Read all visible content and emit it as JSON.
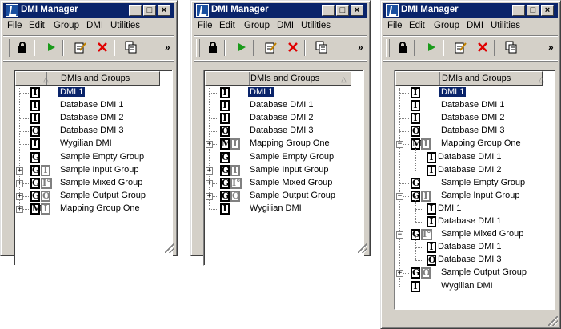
{
  "window": {
    "title": "DMI Manager",
    "controls": {
      "minimize": "_",
      "maximize": "□",
      "close": "×"
    },
    "menu": [
      "File",
      "Edit",
      "Group",
      "DMI",
      "Utilities"
    ],
    "toolbar_more": "»"
  },
  "column_header": "DMIs and Groups",
  "sort_indicator": "△",
  "expand_glyph": "+",
  "collapse_glyph": "−",
  "panels": [
    {
      "rows": [
        {
          "label": "DMI 1",
          "icon": "I",
          "selected": true
        },
        {
          "label": "Database DMI 1",
          "icon": "I"
        },
        {
          "label": "Database DMI 2",
          "icon": "I"
        },
        {
          "label": "Database DMI 3",
          "icon": "O"
        },
        {
          "label": "Wygilian DMI",
          "icon": "I"
        },
        {
          "label": "Sample Empty Group",
          "icon": "G"
        },
        {
          "label": "Sample Input Group",
          "icon": "GI",
          "expand": "+"
        },
        {
          "label": "Sample Mixed Group",
          "icon": "GIO",
          "expand": "+"
        },
        {
          "label": "Sample Output Group",
          "icon": "GO",
          "expand": "+"
        },
        {
          "label": "Mapping Group One",
          "icon": "MI",
          "expand": "+"
        }
      ]
    },
    {
      "rows": [
        {
          "label": "DMI 1",
          "icon": "I",
          "selected": true
        },
        {
          "label": "Database DMI 1",
          "icon": "I"
        },
        {
          "label": "Database DMI 2",
          "icon": "I"
        },
        {
          "label": "Database DMI 3",
          "icon": "O"
        },
        {
          "label": "Mapping Group One",
          "icon": "MI",
          "expand": "+"
        },
        {
          "label": "Sample Empty Group",
          "icon": "G"
        },
        {
          "label": "Sample Input Group",
          "icon": "GI",
          "expand": "+"
        },
        {
          "label": "Sample Mixed Group",
          "icon": "GIO",
          "expand": "+"
        },
        {
          "label": "Sample Output Group",
          "icon": "GO",
          "expand": "+"
        },
        {
          "label": "Wygilian DMI",
          "icon": "I"
        }
      ]
    },
    {
      "rows": [
        {
          "label": "DMI 1",
          "icon": "I",
          "selected": true
        },
        {
          "label": "Database DMI 1",
          "icon": "I"
        },
        {
          "label": "Database DMI 2",
          "icon": "I"
        },
        {
          "label": "Database DMI 3",
          "icon": "O"
        },
        {
          "label": "Mapping Group One",
          "icon": "MI",
          "expand": "-"
        },
        {
          "label": "Database DMI 1",
          "icon": "I",
          "child": true
        },
        {
          "label": "Database DMI 2",
          "icon": "I",
          "child": true
        },
        {
          "label": "Sample Empty Group",
          "icon": "G"
        },
        {
          "label": "Sample Input Group",
          "icon": "GI",
          "expand": "-"
        },
        {
          "label": "DMI 1",
          "icon": "I",
          "child": true
        },
        {
          "label": "Database DMI 1",
          "icon": "I",
          "child": true
        },
        {
          "label": "Sample Mixed Group",
          "icon": "GIO",
          "expand": "-"
        },
        {
          "label": "Database DMI 1",
          "icon": "I",
          "child": true
        },
        {
          "label": "Database DMI 3",
          "icon": "O",
          "child": true
        },
        {
          "label": "Sample Output Group",
          "icon": "GO",
          "expand": "+"
        },
        {
          "label": "Wygilian DMI",
          "icon": "I"
        }
      ]
    }
  ]
}
